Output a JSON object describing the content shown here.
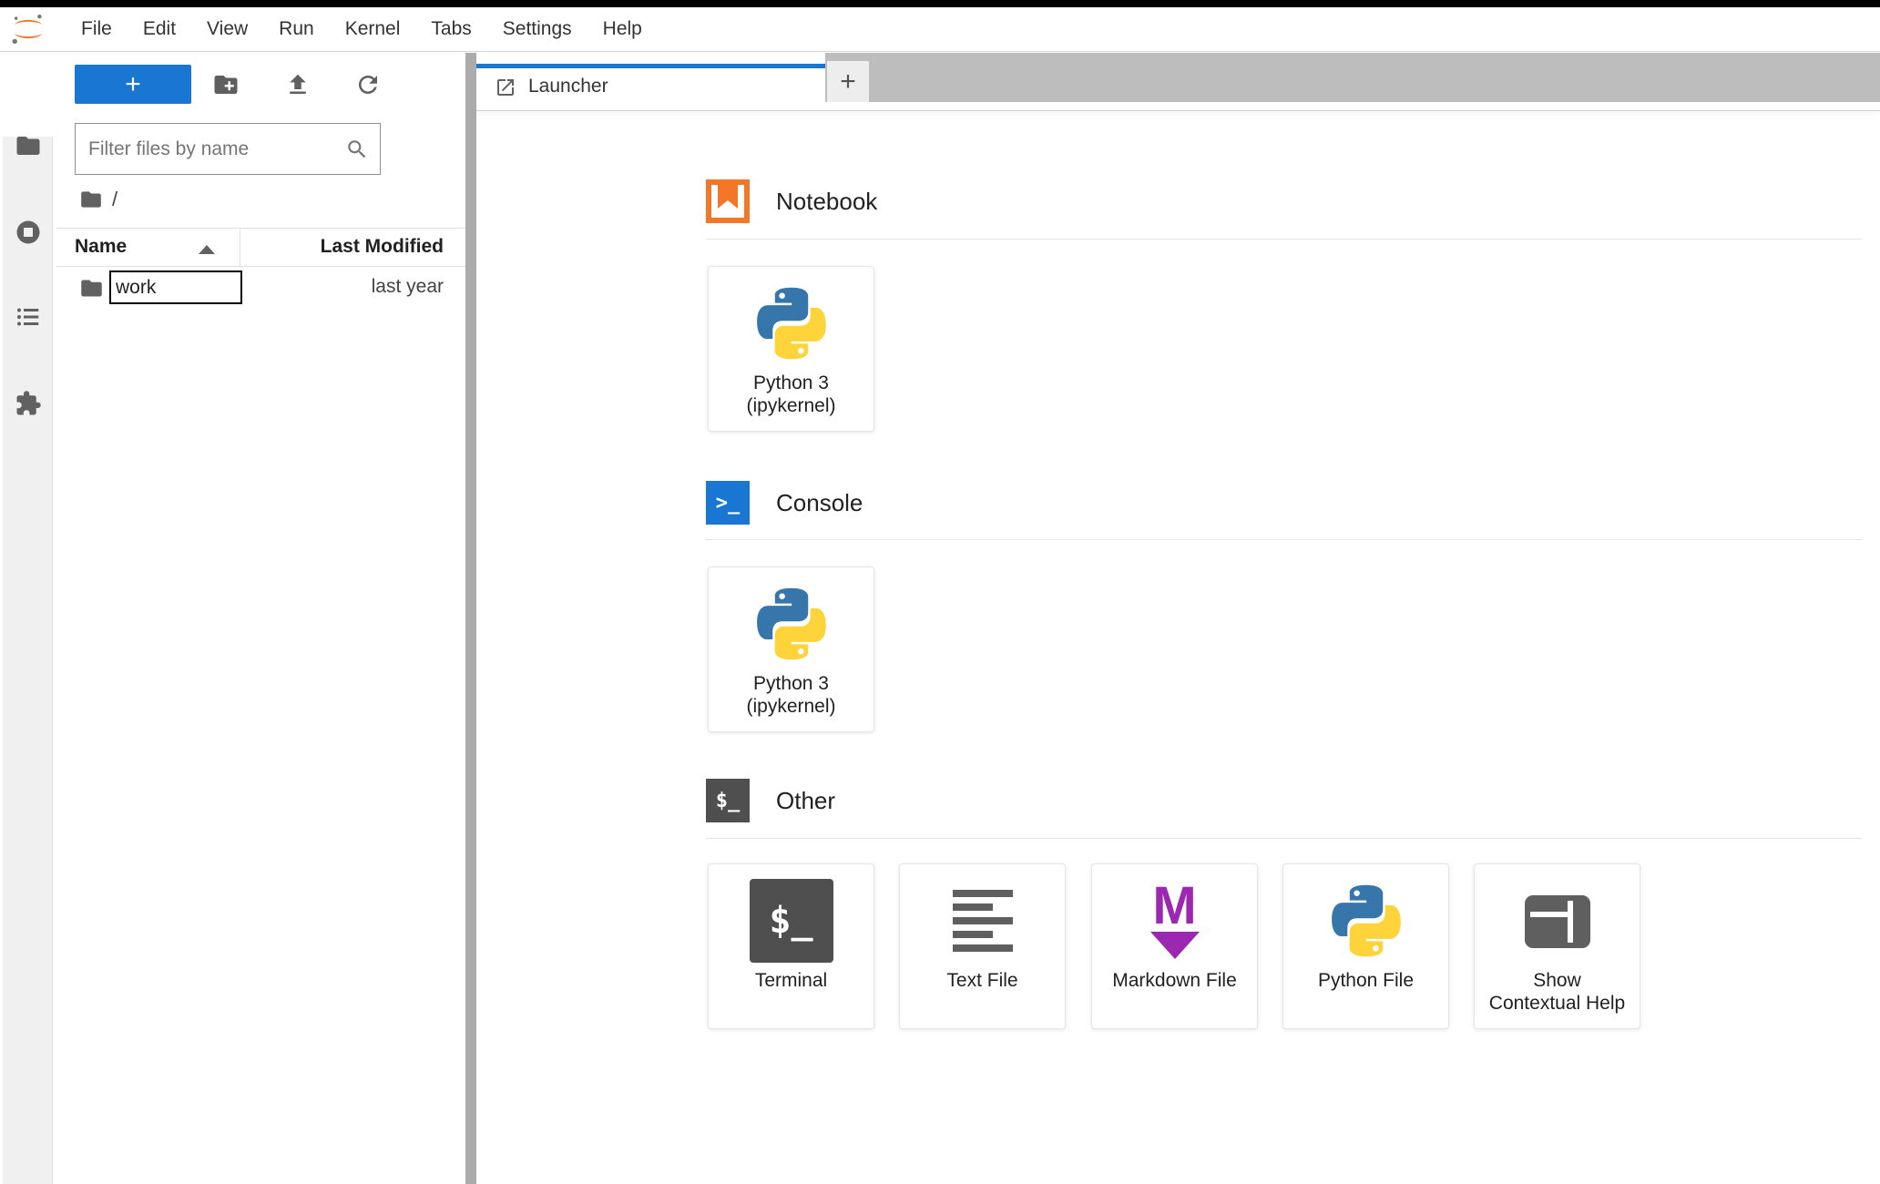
{
  "colors": {
    "accent_blue": "#1976d2",
    "jupyter_orange": "#f37726",
    "tabbar_gray": "#bdbdbd",
    "splitter_gray": "#ababab",
    "icon_gray": "#616161",
    "terminal_dark": "#4f4f4f",
    "markdown_purple": "#9c27b0",
    "python_blue": "#3776ab",
    "python_yellow": "#ffd43b"
  },
  "topbar": {
    "logo": "jupyter-logo",
    "menu_items": [
      "File",
      "Edit",
      "View",
      "Run",
      "Kernel",
      "Tabs",
      "Settings",
      "Help"
    ]
  },
  "sidebar": {
    "items": [
      {
        "icon": "folder-icon",
        "active": true
      },
      {
        "icon": "running-kernels-icon",
        "active": false
      },
      {
        "icon": "table-of-contents-icon",
        "active": false
      },
      {
        "icon": "extensions-icon",
        "active": false
      }
    ]
  },
  "file_browser": {
    "new_launcher_label": "+",
    "toolbar_icons": [
      "new-folder-icon",
      "upload-icon",
      "refresh-icon"
    ],
    "filter": {
      "placeholder": "Filter files by name",
      "value": "",
      "icon": "search-icon"
    },
    "breadcrumb": {
      "icon": "folder-icon",
      "path": "/"
    },
    "columns": {
      "name": "Name",
      "modified": "Last Modified",
      "sort_icon": "sort-ascending-icon"
    },
    "rows": [
      {
        "icon": "folder-icon",
        "name": "work",
        "modified": "last year",
        "editing": true
      }
    ]
  },
  "dock": {
    "tabs": [
      {
        "label": "Launcher",
        "icon": "launcher-icon",
        "active": true
      }
    ],
    "add_tab_label": "+"
  },
  "launcher": {
    "sections": [
      {
        "title": "Notebook",
        "icon": "notebook-icon",
        "cards": [
          {
            "icon": "python-logo-icon",
            "label_lines": [
              "Python 3",
              "(ipykernel)"
            ]
          }
        ]
      },
      {
        "title": "Console",
        "icon": "console-icon",
        "icon_glyph": ">_",
        "cards": [
          {
            "icon": "python-logo-icon",
            "label_lines": [
              "Python 3",
              "(ipykernel)"
            ]
          }
        ]
      },
      {
        "title": "Other",
        "icon": "terminal-section-icon",
        "icon_glyph": "$_",
        "cards": [
          {
            "icon": "terminal-icon",
            "icon_glyph": "$_",
            "label_lines": [
              "Terminal"
            ]
          },
          {
            "icon": "text-file-icon",
            "label_lines": [
              "Text File"
            ]
          },
          {
            "icon": "markdown-icon",
            "icon_glyph": "M",
            "label_lines": [
              "Markdown File"
            ]
          },
          {
            "icon": "python-logo-icon",
            "label_lines": [
              "Python File"
            ]
          },
          {
            "icon": "contextual-help-icon",
            "label_lines": [
              "Show",
              "Contextual Help"
            ]
          }
        ]
      }
    ]
  }
}
